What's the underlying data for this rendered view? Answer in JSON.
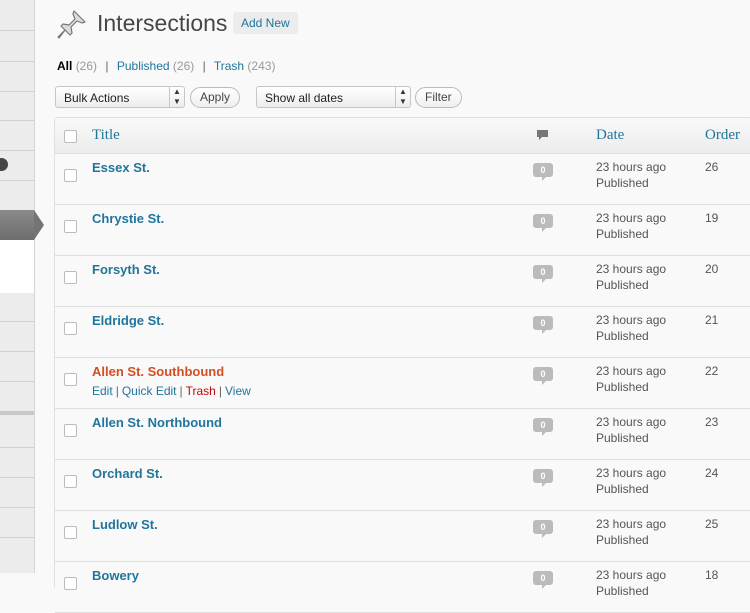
{
  "header": {
    "title": "Intersections",
    "add_new": "Add New"
  },
  "views": [
    {
      "label": "All",
      "count": "(26)"
    },
    {
      "label": "Published",
      "count": "(26)"
    },
    {
      "label": "Trash",
      "count": "(243)"
    }
  ],
  "toolbar": {
    "bulk_actions": "Bulk Actions",
    "apply": "Apply",
    "dates": "Show all dates",
    "filter": "Filter"
  },
  "table": {
    "columns": {
      "title": "Title",
      "date": "Date",
      "order": "Order"
    },
    "row_actions": {
      "edit": "Edit",
      "quick_edit": "Quick Edit",
      "trash": "Trash",
      "view": "View"
    },
    "rows": [
      {
        "title": "Essex St.",
        "comments": "0",
        "date": "23 hours ago",
        "status": "Published",
        "order": "26"
      },
      {
        "title": "Chrystie St.",
        "comments": "0",
        "date": "23 hours ago",
        "status": "Published",
        "order": "19"
      },
      {
        "title": "Forsyth St.",
        "comments": "0",
        "date": "23 hours ago",
        "status": "Published",
        "order": "20"
      },
      {
        "title": "Eldridge St.",
        "comments": "0",
        "date": "23 hours ago",
        "status": "Published",
        "order": "21"
      },
      {
        "title": "Allen St. Southbound",
        "comments": "0",
        "date": "23 hours ago",
        "status": "Published",
        "order": "22"
      },
      {
        "title": "Allen St. Northbound",
        "comments": "0",
        "date": "23 hours ago",
        "status": "Published",
        "order": "23"
      },
      {
        "title": "Orchard St.",
        "comments": "0",
        "date": "23 hours ago",
        "status": "Published",
        "order": "24"
      },
      {
        "title": "Ludlow St.",
        "comments": "0",
        "date": "23 hours ago",
        "status": "Published",
        "order": "25"
      },
      {
        "title": "Bowery",
        "comments": "0",
        "date": "23 hours ago",
        "status": "Published",
        "order": "18"
      }
    ]
  },
  "colors": {
    "link": "#21759b",
    "hover_title": "#d54e21",
    "trash": "#bc0b0b"
  },
  "icons": {
    "page_icon": "pushpin-icon",
    "comments_header": "comment-bubble-icon"
  }
}
